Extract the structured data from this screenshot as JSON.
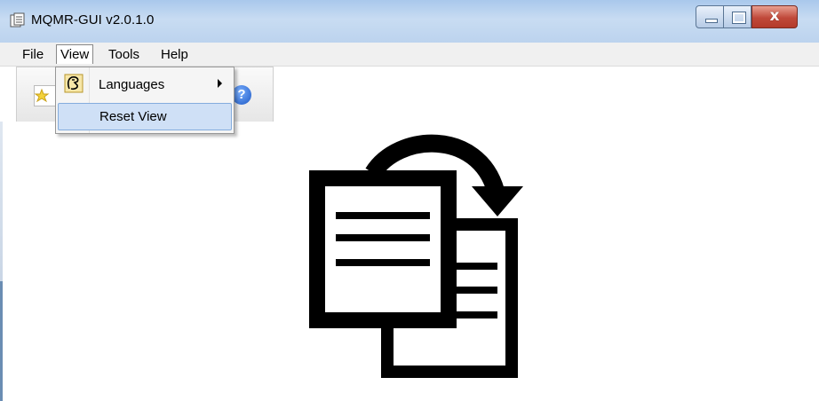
{
  "window": {
    "title": "MQMR-GUI v2.0.1.0",
    "close_glyph": "x"
  },
  "menubar": {
    "items": [
      "File",
      "View",
      "Tools",
      "Help"
    ],
    "active": "View"
  },
  "view_menu": {
    "items": [
      {
        "label": "Languages",
        "icon": "languages-icon",
        "has_submenu": true
      },
      {
        "label": "Reset View",
        "icon": "",
        "highlighted": true
      }
    ]
  },
  "toolbar": {
    "buttons": [
      "new-icon",
      "help-icon"
    ],
    "help_glyph": "?"
  },
  "main": {
    "icon": "copy-documents-icon"
  },
  "colors": {
    "titlebar": "#bcd3ee",
    "menu_highlight": "#cfe0f6",
    "close_button": "#c0493a"
  }
}
